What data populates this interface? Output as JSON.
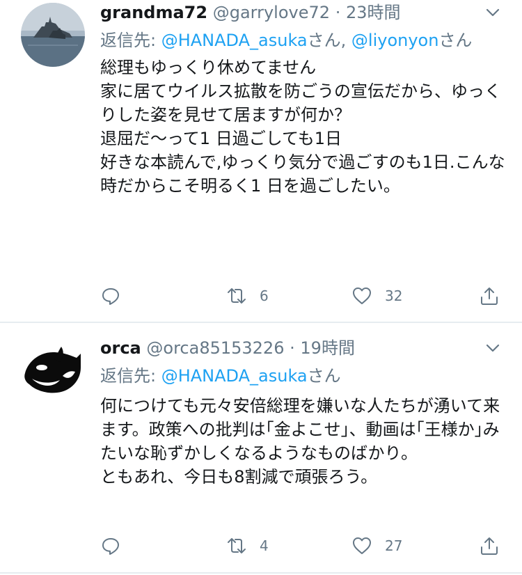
{
  "tweets": [
    {
      "display_name": "grandma72",
      "handle": "@garrylove72",
      "separator": "·",
      "time": "23時間",
      "reply_prefix": "返信先: ",
      "mention1": "@HANADA_asuka",
      "suffix1": "さん, ",
      "mention2": "@liyonyon",
      "suffix2": "さん",
      "text": "総理もゆっくり休めてません\n家に居てウイルス拡散を防ごうの宣伝だから、ゆっくりした姿を見せて居ますが何か？\n退屈だ〜って1 日過ごしても1日\n好きな本読んで,ゆっくり気分で過ごすのも1日.こんな時だからこそ明るく1 日を過ごしたい。",
      "retweets": "6",
      "likes": "32"
    },
    {
      "display_name": "orca",
      "handle": "@orca85153226",
      "separator": "·",
      "time": "19時間",
      "reply_prefix": "返信先: ",
      "mention1": "@HANADA_asuka",
      "suffix1": "さん",
      "text": "何につけても元々安倍総理を嫌いな人たちが湧いて来ます。政策への批判は｢金よこせ｣、動画は｢王様か｣みたいな恥ずかしくなるようなものばかり。\nともあれ、今日も8割減で頑張ろう。",
      "retweets": "4",
      "likes": "27"
    }
  ],
  "icons": {
    "caret": "chevron-down-icon",
    "reply": "reply-icon",
    "retweet": "retweet-icon",
    "like": "heart-icon",
    "share": "share-icon"
  },
  "colors": {
    "link": "#1da1f2",
    "secondary": "#657786",
    "divider": "#e6ecf0"
  }
}
